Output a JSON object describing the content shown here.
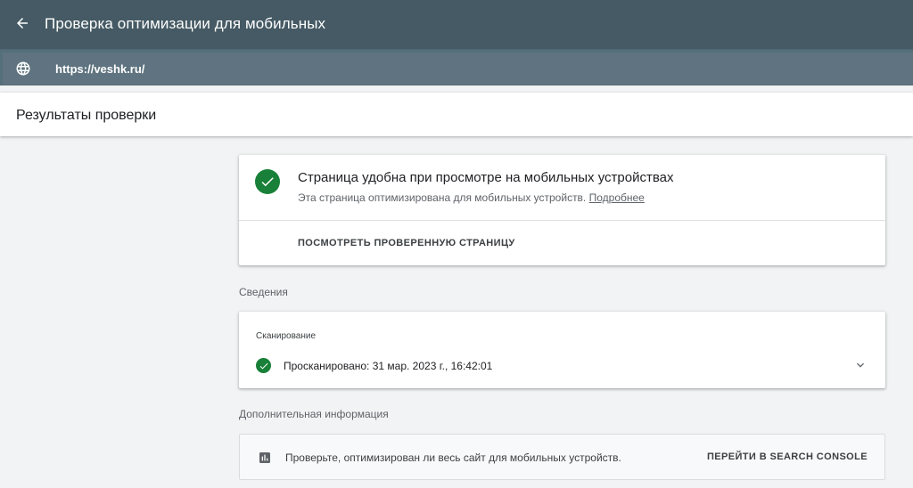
{
  "appbar": {
    "title": "Проверка оптимизации для мобильных",
    "back_icon": "arrow-left-icon"
  },
  "urlbar": {
    "url": "https://veshk.ru/",
    "globe_icon": "globe-icon"
  },
  "results": {
    "title": "Результаты проверки"
  },
  "main_card": {
    "title": "Страница удобна при просмотре на мобильных устройствах",
    "subtitle": "Эта страница оптимизирована для мобильных устройств.",
    "more_link": "Подробнее",
    "view_button": "ПОСМОТРЕТЬ ПРОВЕРЕННУЮ СТРАНИЦУ",
    "status_color": "#188038"
  },
  "details": {
    "section_label": "Сведения",
    "scan_label": "Сканирование",
    "scan_text": "Просканировано: 31 мар. 2023 г., 16:42:01"
  },
  "additional": {
    "section_label": "Дополнительная информация",
    "text": "Проверьте, оптимизирован ли весь сайт для мобильных устройств.",
    "button": "ПЕРЕЙТИ В SEARCH CONSOLE"
  }
}
